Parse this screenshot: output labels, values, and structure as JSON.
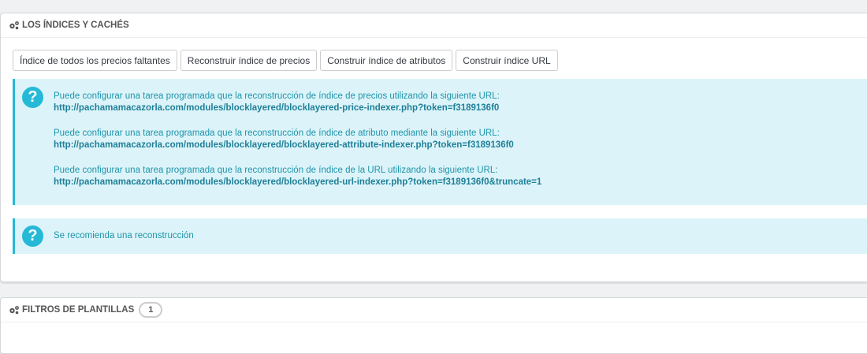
{
  "indexes_panel": {
    "title": "LOS ÍNDICES Y CACHÉS",
    "buttons": [
      "Índice de todos los precios faltantes",
      "Reconstruir índice de precios",
      "Construir índice de atributos",
      "Construir índice URL"
    ],
    "info_alert": {
      "blocks": [
        {
          "text": "Puede configurar una tarea programada que la reconstrucción de índice de precios utilizando la siguiente URL:",
          "url": "http://pachamamacazorla.com/modules/blocklayered/blocklayered-price-indexer.php?token=f3189136f0"
        },
        {
          "text": "Puede configurar una tarea programada que la reconstrucción de índice de atributo mediante la siguiente URL:",
          "url": "http://pachamamacazorla.com/modules/blocklayered/blocklayered-attribute-indexer.php?token=f3189136f0"
        },
        {
          "text": "Puede configurar una tarea programada que la reconstrucción de índice de la URL utilizando la siguiente URL:",
          "url": "http://pachamamacazorla.com/modules/blocklayered/blocklayered-url-indexer.php?token=f3189136f0&truncate=1"
        }
      ]
    },
    "recommend_alert": {
      "text": "Se recomienda una reconstrucción"
    }
  },
  "filters_panel": {
    "title": "FILTROS DE PLANTILLAS",
    "count": "1"
  },
  "colors": {
    "info_bg": "#dcf4f9",
    "info_border": "#25b9d7",
    "info_text": "#1e94ab"
  },
  "icons": [
    "gears-icon",
    "question-circle-icon"
  ]
}
